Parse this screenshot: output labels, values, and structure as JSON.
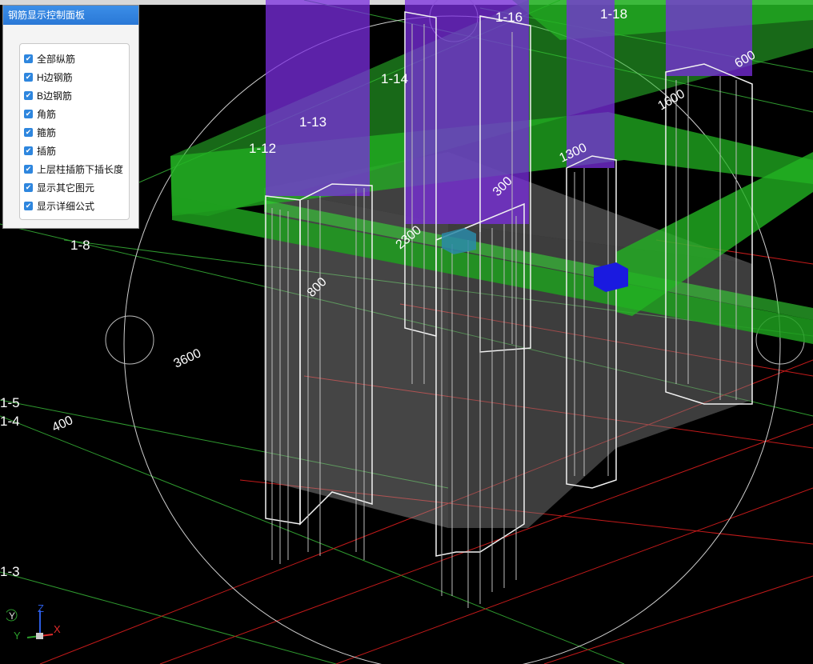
{
  "panel": {
    "title": "钢筋显示控制面板",
    "options": [
      {
        "label": "全部纵筋",
        "checked": true
      },
      {
        "label": "H边钢筋",
        "checked": true
      },
      {
        "label": "B边钢筋",
        "checked": true
      },
      {
        "label": "角筋",
        "checked": true
      },
      {
        "label": "箍筋",
        "checked": true
      },
      {
        "label": "插筋",
        "checked": true
      },
      {
        "label": "上层柱插筋下插长度",
        "checked": true
      },
      {
        "label": "显示其它图元",
        "checked": true
      },
      {
        "label": "显示详细公式",
        "checked": true
      }
    ]
  },
  "scene": {
    "column_labels": [
      "1-12",
      "1-13",
      "1-14",
      "1-16",
      "1-18"
    ],
    "grid_labels": [
      "1-8",
      "1-5",
      "1-4",
      "1-3"
    ],
    "dimensions": [
      "3600",
      "400",
      "1300",
      "2300",
      "1600",
      "600",
      "800",
      "300"
    ],
    "colors": {
      "beam": "#22b222",
      "column_top": "#7b2ee0",
      "marker": "#1a1ae0"
    }
  },
  "axes": {
    "x": "X",
    "y": "Y",
    "z": "Z",
    "y_side": "Y"
  }
}
